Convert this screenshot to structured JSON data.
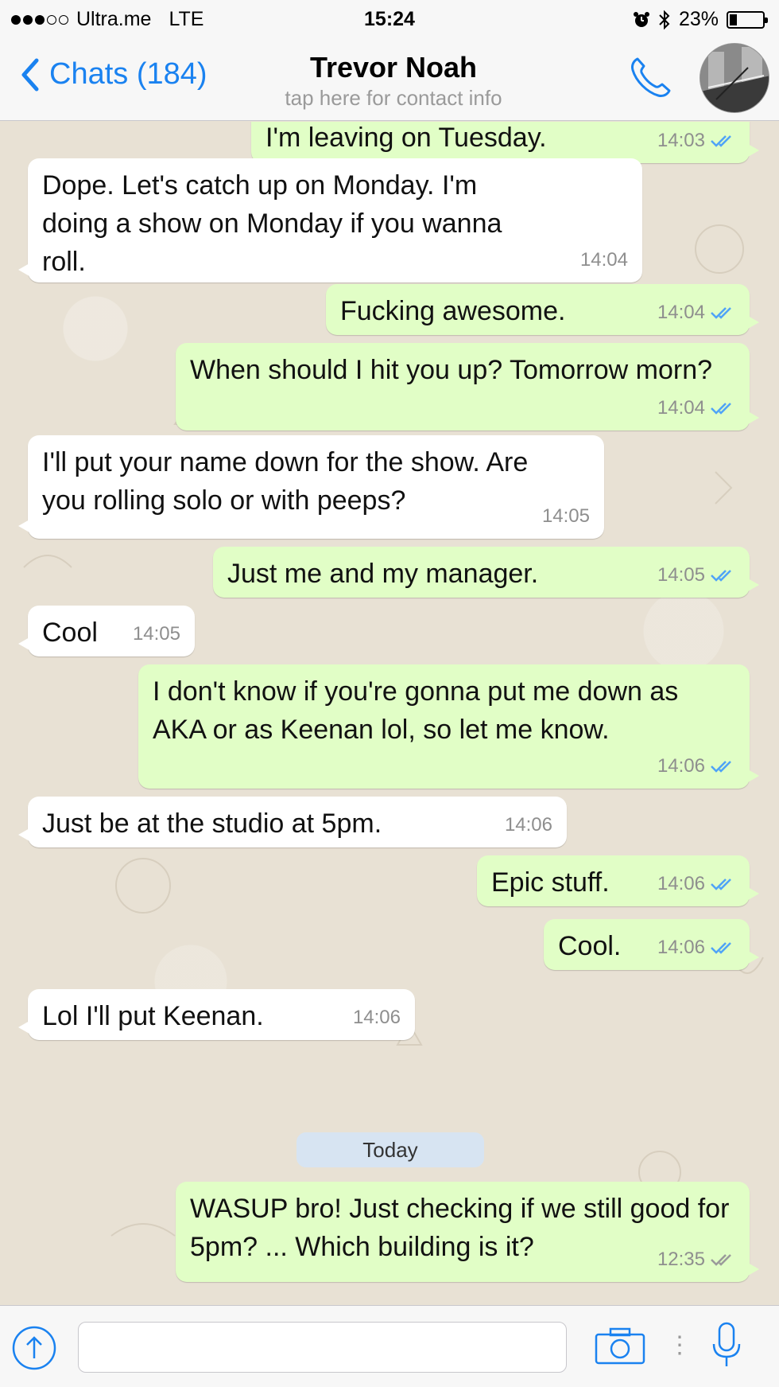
{
  "status_bar": {
    "carrier": "Ultra.me",
    "network": "LTE",
    "time": "15:24",
    "battery_text": "23%",
    "battery_level": 0.23,
    "signal_bars_filled": 3,
    "signal_bars_total": 5
  },
  "header": {
    "back_label": "Chats (184)",
    "contact_name": "Trevor Noah",
    "contact_subtitle": "tap here for contact info"
  },
  "colors": {
    "accent": "#1a82f0",
    "outgoing_bubble": "#e1fec6",
    "incoming_bubble": "#ffffff",
    "read_ticks": "#4fa3f7",
    "sent_ticks": "#9a9a9a"
  },
  "messages": [
    {
      "text": "I'm leaving on Tuesday.",
      "time": "14:03",
      "direction": "out",
      "status": "read"
    },
    {
      "text": "Dope. Let's catch up on Monday. I'm doing a show on Monday if you wanna roll.",
      "time": "14:04",
      "direction": "in"
    },
    {
      "text": "Fucking awesome.",
      "time": "14:04",
      "direction": "out",
      "status": "read"
    },
    {
      "text": "When should I hit you up? Tomorrow morn?",
      "time": "14:04",
      "direction": "out",
      "status": "read"
    },
    {
      "text": "I'll put your name down for the show. Are you rolling solo or with peeps?",
      "time": "14:05",
      "direction": "in"
    },
    {
      "text": "Just me and my manager.",
      "time": "14:05",
      "direction": "out",
      "status": "read"
    },
    {
      "text": "Cool",
      "time": "14:05",
      "direction": "in"
    },
    {
      "text": "I don't know if you're gonna put me down as AKA or as Keenan lol, so let me know.",
      "time": "14:06",
      "direction": "out",
      "status": "read"
    },
    {
      "text": "Just be at the studio at 5pm.",
      "time": "14:06",
      "direction": "in"
    },
    {
      "text": "Epic stuff.",
      "time": "14:06",
      "direction": "out",
      "status": "read"
    },
    {
      "text": "Cool.",
      "time": "14:06",
      "direction": "out",
      "status": "read"
    },
    {
      "text": "Lol I'll put Keenan.",
      "time": "14:06",
      "direction": "in"
    },
    {
      "text": "WASUP bro! Just checking if we still good for 5pm? ... Which building is it?",
      "time": "12:35",
      "direction": "out",
      "status": "sent"
    }
  ],
  "date_separator": "Today",
  "input": {
    "value": "",
    "icons": [
      "share-icon",
      "camera-icon",
      "microphone-icon"
    ]
  }
}
